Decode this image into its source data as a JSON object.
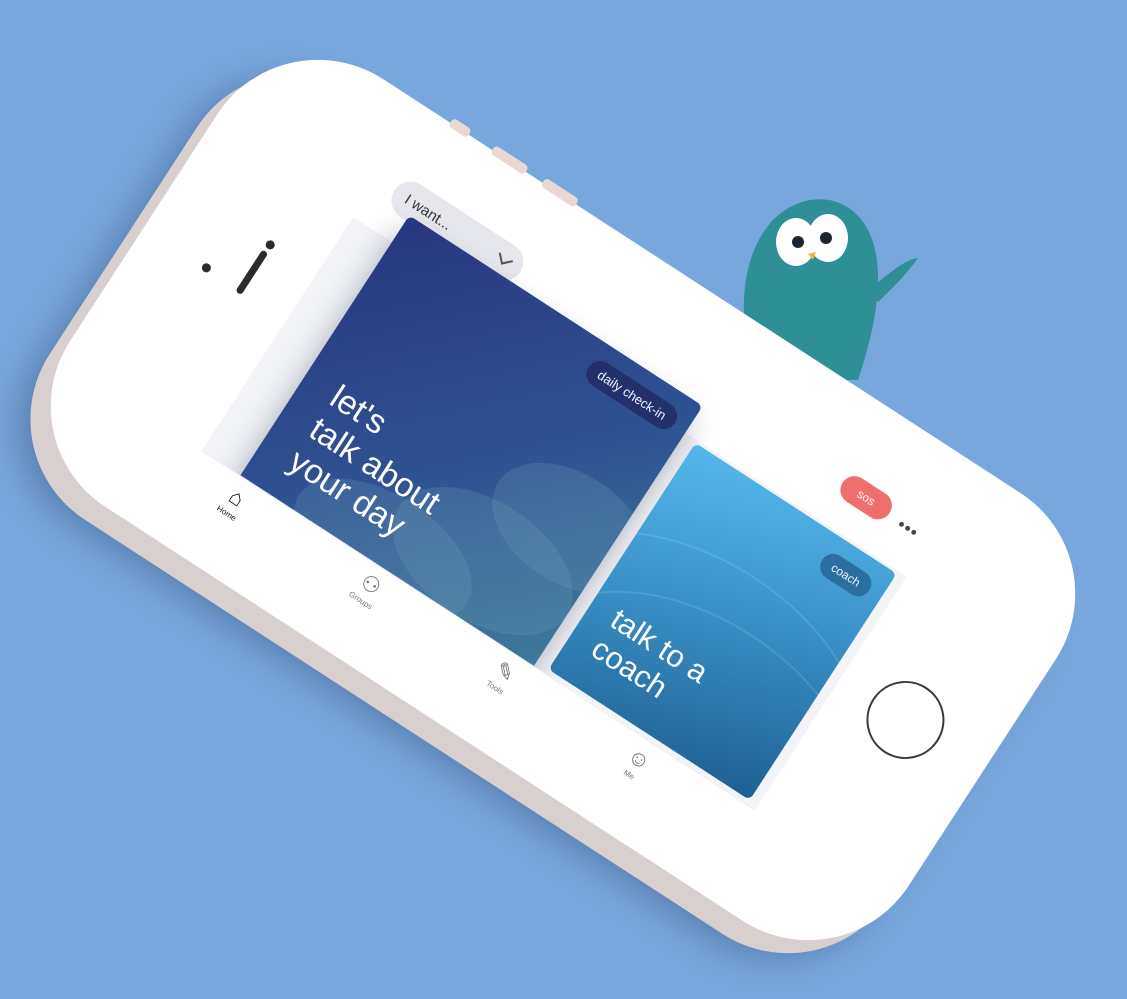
{
  "colors": {
    "background": "#78a7dd",
    "sos_button": "#ef6f6c",
    "checkin_card": "#2e5392",
    "coach_card": "#3b92c9",
    "mascot": "#2f8f97"
  },
  "header": {
    "intent_dropdown": "I want...",
    "sos_label": "sos",
    "more_icon": "more-dots-icon"
  },
  "cards": [
    {
      "tag": "daily check-in",
      "title_lines": [
        "let's",
        "talk about",
        "your day"
      ]
    },
    {
      "tag": "coach",
      "title_lines": [
        "talk to a",
        "coach"
      ]
    }
  ],
  "tabs": [
    {
      "label": "Home",
      "icon": "home-icon",
      "active": true
    },
    {
      "label": "Groups",
      "icon": "groups-icon",
      "active": false
    },
    {
      "label": "Tools",
      "icon": "tools-icon",
      "active": false
    },
    {
      "label": "Me",
      "icon": "profile-icon",
      "active": false
    }
  ],
  "mascot": "penguin-mascot"
}
